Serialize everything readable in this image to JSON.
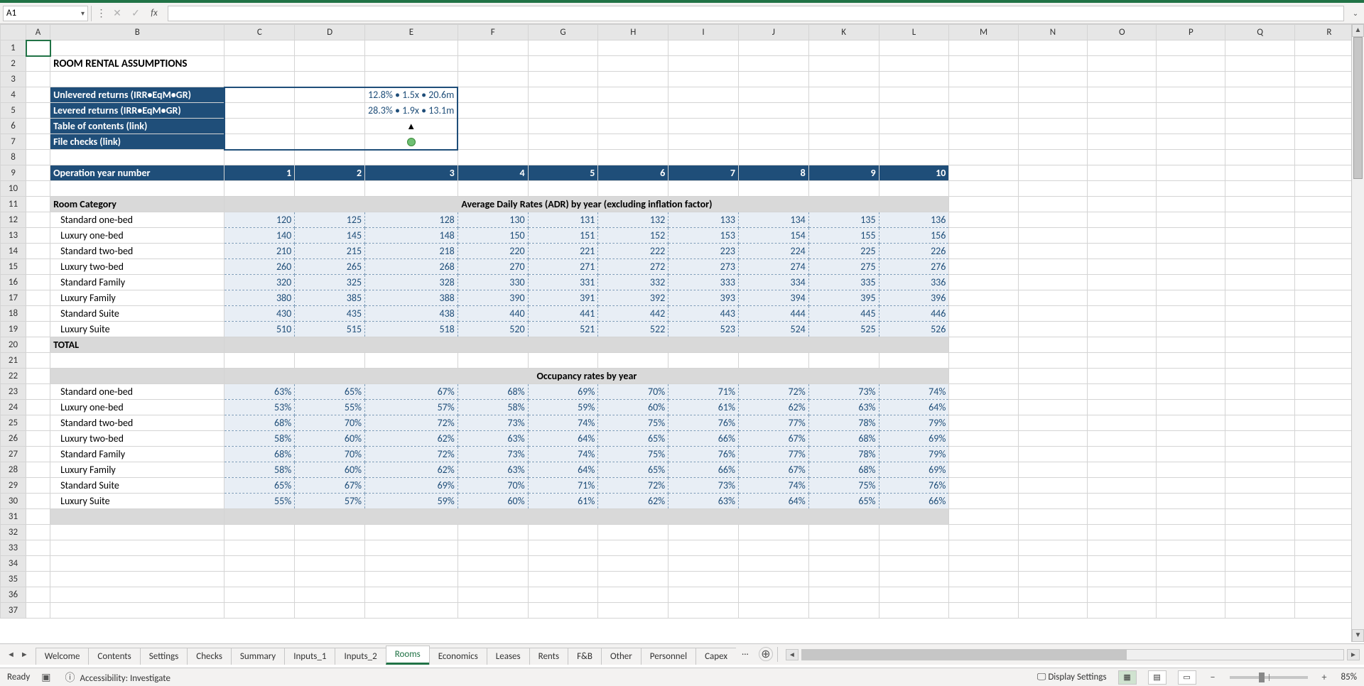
{
  "nameBox": "A1",
  "fxLabel": "fx",
  "columns": [
    "A",
    "B",
    "C",
    "D",
    "E",
    "F",
    "G",
    "H",
    "I",
    "J",
    "K",
    "L",
    "M",
    "N",
    "O",
    "P",
    "Q",
    "R"
  ],
  "rows": [
    1,
    2,
    3,
    4,
    5,
    6,
    7,
    8,
    9,
    10,
    11,
    12,
    13,
    14,
    15,
    16,
    17,
    18,
    19,
    20,
    21,
    22,
    23,
    24,
    25,
    26,
    27,
    28,
    29,
    30,
    31,
    32,
    33,
    34,
    35,
    36,
    37
  ],
  "title": "ROOM RENTAL ASSUMPTIONS",
  "summaryBox": [
    {
      "label": "Unlevered returns (IRR•EqM•GR)",
      "value": "12.8% • 1.5x • 20.6m"
    },
    {
      "label": "Levered returns (IRR•EqM•GR)",
      "value": "28.3% • 1.9x • 13.1m"
    },
    {
      "label": "Table of contents (link)",
      "value": "▲",
      "type": "triangle"
    },
    {
      "label": "File checks (link)",
      "value": "●",
      "type": "dot"
    }
  ],
  "yearHeader": {
    "label": "Operation year number",
    "years": [
      "1",
      "2",
      "3",
      "4",
      "5",
      "6",
      "7",
      "8",
      "9",
      "10"
    ]
  },
  "section1": {
    "left": "Room Category",
    "center": "Average Daily Rates (ADR) by year (excluding inflation factor)"
  },
  "categories": [
    "Standard one-bed",
    "Luxury one-bed",
    "Standard two-bed",
    "Luxury two-bed",
    "Standard Family",
    "Luxury Family",
    "Standard Suite",
    "Luxury Suite"
  ],
  "adr": [
    [
      "120",
      "125",
      "128",
      "130",
      "131",
      "132",
      "133",
      "134",
      "135",
      "136"
    ],
    [
      "140",
      "145",
      "148",
      "150",
      "151",
      "152",
      "153",
      "154",
      "155",
      "156"
    ],
    [
      "210",
      "215",
      "218",
      "220",
      "221",
      "222",
      "223",
      "224",
      "225",
      "226"
    ],
    [
      "260",
      "265",
      "268",
      "270",
      "271",
      "272",
      "273",
      "274",
      "275",
      "276"
    ],
    [
      "320",
      "325",
      "328",
      "330",
      "331",
      "332",
      "333",
      "334",
      "335",
      "336"
    ],
    [
      "380",
      "385",
      "388",
      "390",
      "391",
      "392",
      "393",
      "394",
      "395",
      "396"
    ],
    [
      "430",
      "435",
      "438",
      "440",
      "441",
      "442",
      "443",
      "444",
      "445",
      "446"
    ],
    [
      "510",
      "515",
      "518",
      "520",
      "521",
      "522",
      "523",
      "524",
      "525",
      "526"
    ]
  ],
  "totalLabel": "TOTAL",
  "section2": {
    "center": "Occupancy rates by year"
  },
  "occ": [
    [
      "63%",
      "65%",
      "67%",
      "68%",
      "69%",
      "70%",
      "71%",
      "72%",
      "73%",
      "74%"
    ],
    [
      "53%",
      "55%",
      "57%",
      "58%",
      "59%",
      "60%",
      "61%",
      "62%",
      "63%",
      "64%"
    ],
    [
      "68%",
      "70%",
      "72%",
      "73%",
      "74%",
      "75%",
      "76%",
      "77%",
      "78%",
      "79%"
    ],
    [
      "58%",
      "60%",
      "62%",
      "63%",
      "64%",
      "65%",
      "66%",
      "67%",
      "68%",
      "69%"
    ],
    [
      "68%",
      "70%",
      "72%",
      "73%",
      "74%",
      "75%",
      "76%",
      "77%",
      "78%",
      "79%"
    ],
    [
      "58%",
      "60%",
      "62%",
      "63%",
      "64%",
      "65%",
      "66%",
      "67%",
      "68%",
      "69%"
    ],
    [
      "65%",
      "67%",
      "69%",
      "70%",
      "71%",
      "72%",
      "73%",
      "74%",
      "75%",
      "76%"
    ],
    [
      "55%",
      "57%",
      "59%",
      "60%",
      "61%",
      "62%",
      "63%",
      "64%",
      "65%",
      "66%"
    ]
  ],
  "tabs": [
    "Welcome",
    "Contents",
    "Settings",
    "Checks",
    "Summary",
    "Inputs_1",
    "Inputs_2",
    "Rooms",
    "Economics",
    "Leases",
    "Rents",
    "F&B",
    "Other",
    "Personnel",
    "Capex"
  ],
  "activeTab": "Rooms",
  "tabMore": "...",
  "status": {
    "ready": "Ready",
    "accessibility": "Accessibility: Investigate",
    "displaySettings": "Display Settings",
    "zoom": "85%"
  }
}
